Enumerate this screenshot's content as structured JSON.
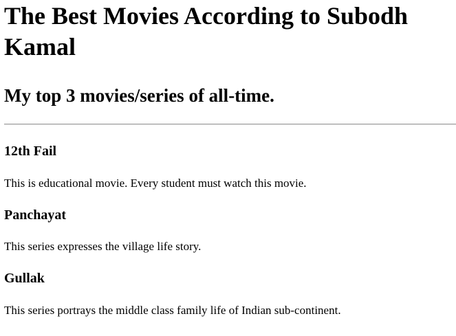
{
  "page": {
    "title": "The Best Movies According to Subodh Kamal",
    "subtitle": "My top 3 movies/series of all-time."
  },
  "movies": [
    {
      "name": "12th Fail",
      "description": "This is educational movie. Every student must watch this movie."
    },
    {
      "name": "Panchayat",
      "description": "This series expresses the village life story."
    },
    {
      "name": "Gullak",
      "description": "This series portrays the middle class family life of Indian sub-continent."
    }
  ]
}
